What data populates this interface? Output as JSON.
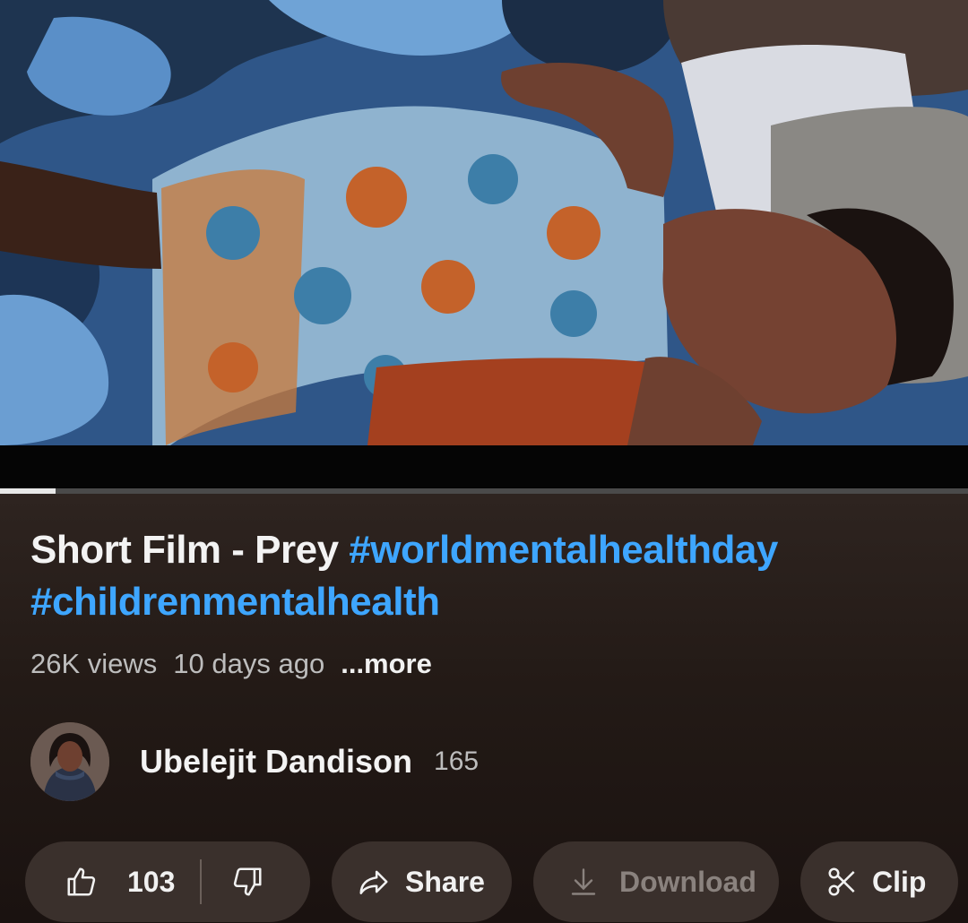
{
  "video": {
    "progress_fraction": 0.057
  },
  "title": {
    "text": "Short Film - Prey ",
    "hashtag_1": "#worldmentalhealthday",
    "hashtag_2": "#childrenmentalhealth"
  },
  "meta": {
    "views": "26K views",
    "age": "10 days ago",
    "more": "...more"
  },
  "channel": {
    "name": "Ubelejit Dandison",
    "subscribers": "165"
  },
  "actions": {
    "like_count": "103",
    "share_label": "Share",
    "download_label": "Download",
    "clip_label": "Clip"
  },
  "icons": {
    "like": "thumbs-up-icon",
    "dislike": "thumbs-down-icon",
    "share": "share-arrow-icon",
    "download": "download-icon",
    "clip": "scissors-icon"
  },
  "colors": {
    "hashtag": "#3ea6ff",
    "pill_bg": "#3a302c",
    "disabled_text": "#8a827e"
  }
}
